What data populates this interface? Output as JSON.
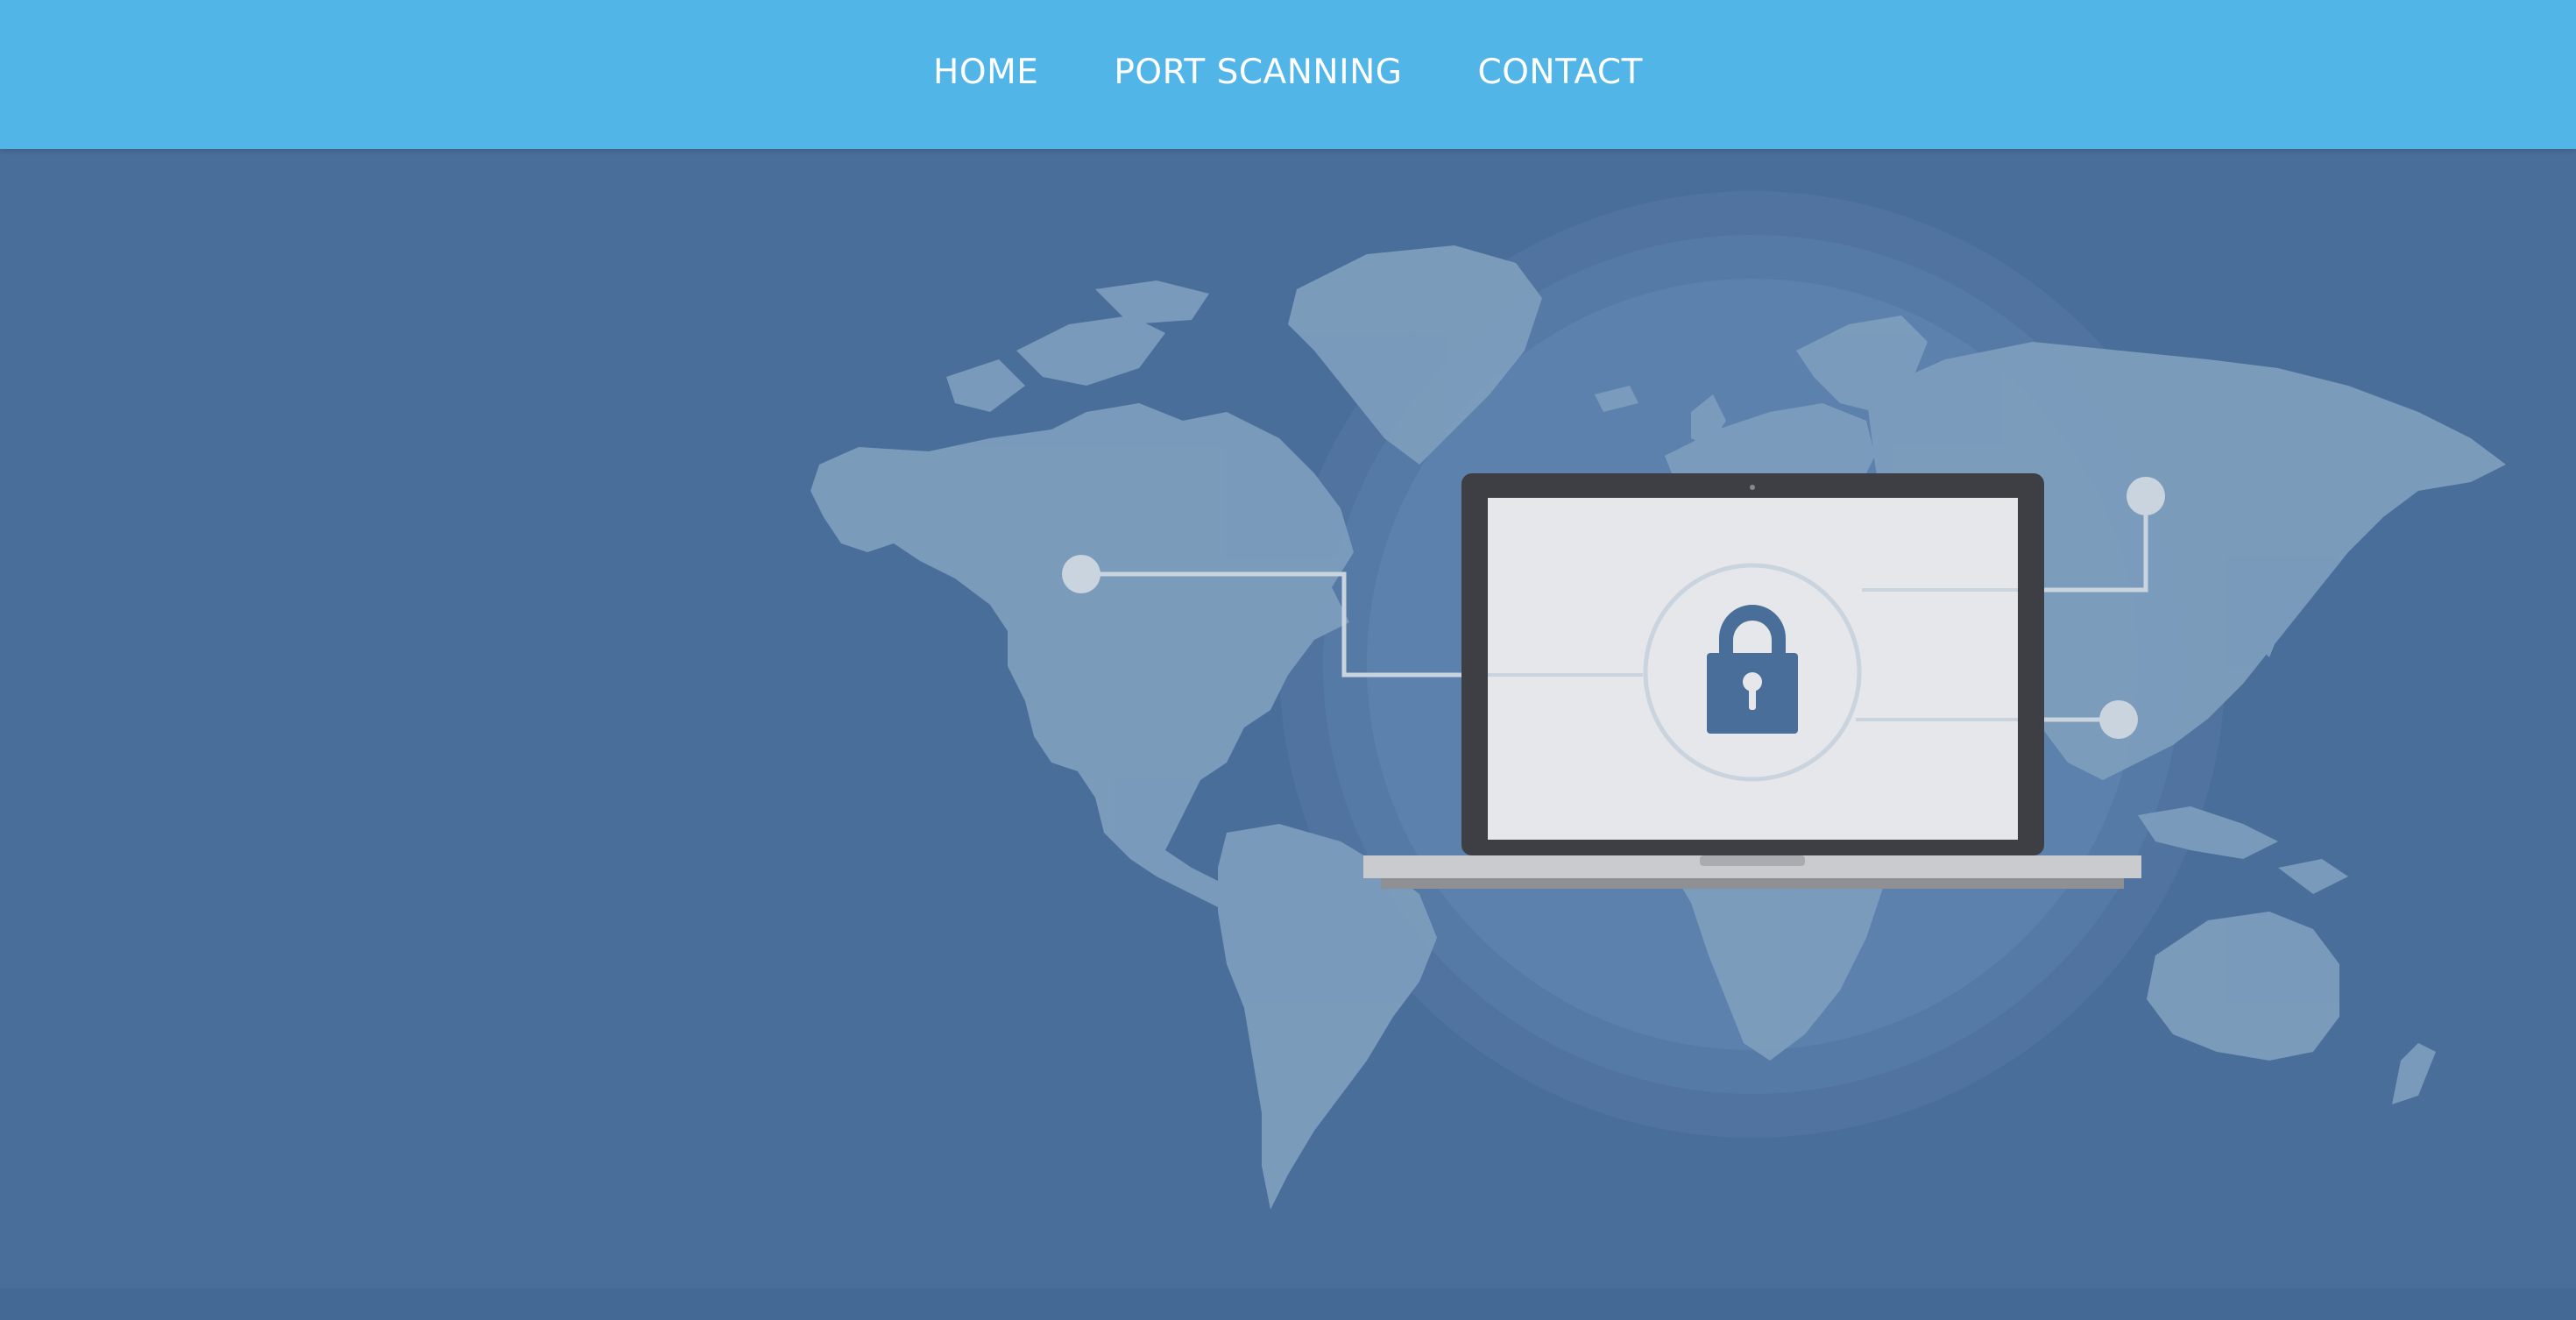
{
  "nav": {
    "items": [
      {
        "label": "HOME"
      },
      {
        "label": "PORT SCANNING"
      },
      {
        "label": "CONTACT"
      }
    ]
  },
  "colors": {
    "navbar": "#52b5e8",
    "hero_background": "#4a6e9a",
    "continents": "#7d9dbd",
    "glow": "#6b8db4",
    "screen": "#e6e7ea",
    "laptop_frame": "#3d3f44",
    "lock": "#4a6e9a"
  },
  "hero": {
    "image": "world-map-laptop-padlock-illustration"
  }
}
